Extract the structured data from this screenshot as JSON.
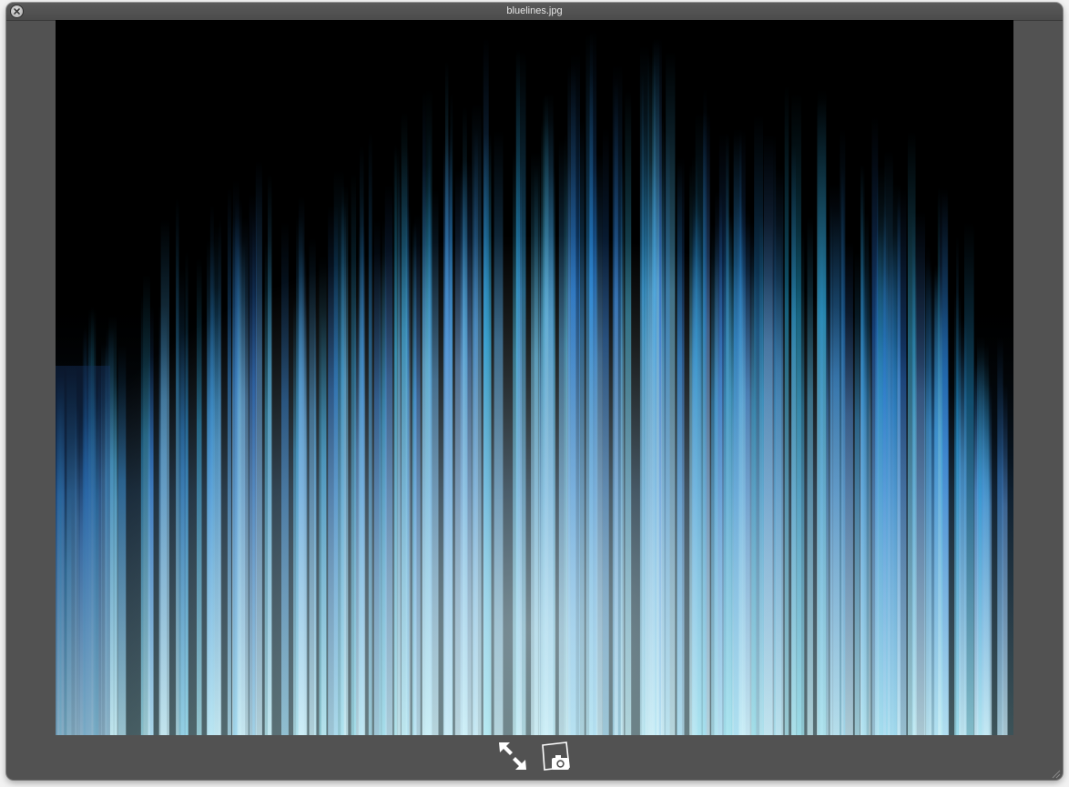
{
  "window": {
    "title": "bluelines.jpg",
    "background_color": "#525252"
  },
  "titlebar": {
    "close_icon": "close-icon"
  },
  "image": {
    "description_colors": {
      "background": "#000000",
      "highlight": "#cfeefc",
      "mid": "#4aa6e6",
      "deep": "#1a3f7a"
    }
  },
  "toolbar": {
    "fullscreen_icon": "fullscreen-arrows-icon",
    "iphoto_icon": "add-to-iphoto-icon"
  },
  "resize_icon": "resize-grip-icon"
}
